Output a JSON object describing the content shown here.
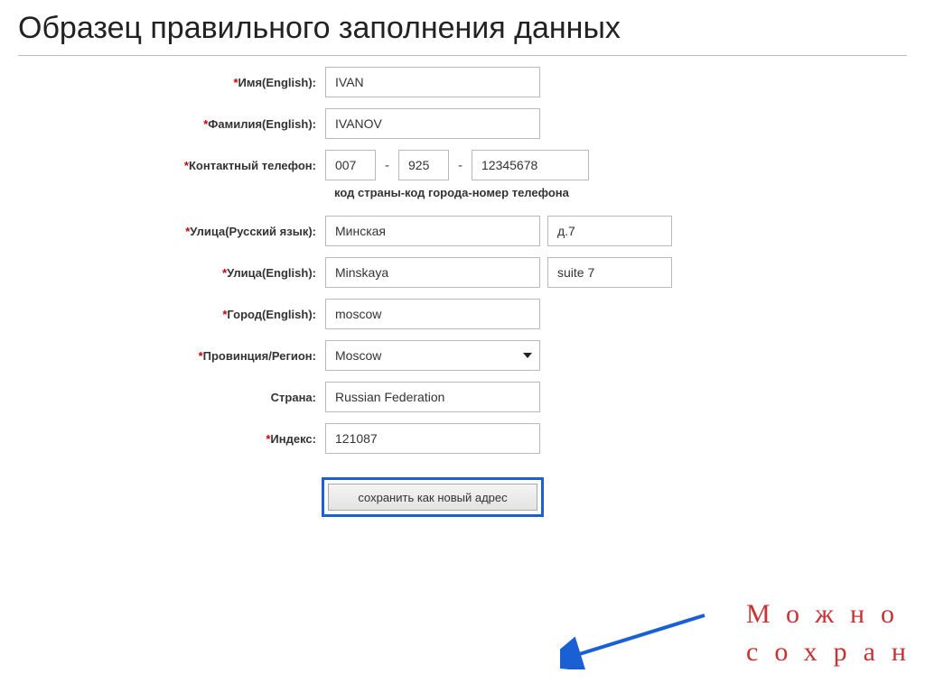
{
  "title": "Образец правильного заполнения данных",
  "form": {
    "first_name": {
      "label": "Имя(English)",
      "value": "IVAN",
      "required": true
    },
    "last_name": {
      "label": "Фамилия(English)",
      "value": "IVANOV",
      "required": true
    },
    "phone": {
      "label": "Контактный телефон",
      "required": true,
      "country_code": "007",
      "area_code": "925",
      "number": "12345678",
      "hint": "код страны-код города-номер телефона",
      "dash": "-"
    },
    "street_ru": {
      "label": "Улица(Русский язык)",
      "main": "Минская",
      "aux": "д.7",
      "required": true
    },
    "street_en": {
      "label": "Улица(English)",
      "main": "Minskaya",
      "aux": "suite 7",
      "required": true
    },
    "city": {
      "label": "Город(English)",
      "value": "moscow",
      "required": true
    },
    "region": {
      "label": "Провинция/Регион",
      "value": "Moscow",
      "required": true
    },
    "country": {
      "label": "Страна",
      "value": "Russian Federation",
      "required": false
    },
    "zip": {
      "label": "Индекс",
      "value": "121087",
      "required": true
    },
    "save_button": "сохранить как новый адрес"
  },
  "annotation": {
    "line1": "Можно",
    "line2": "сохран"
  },
  "asterisk": "*",
  "colon": ":"
}
